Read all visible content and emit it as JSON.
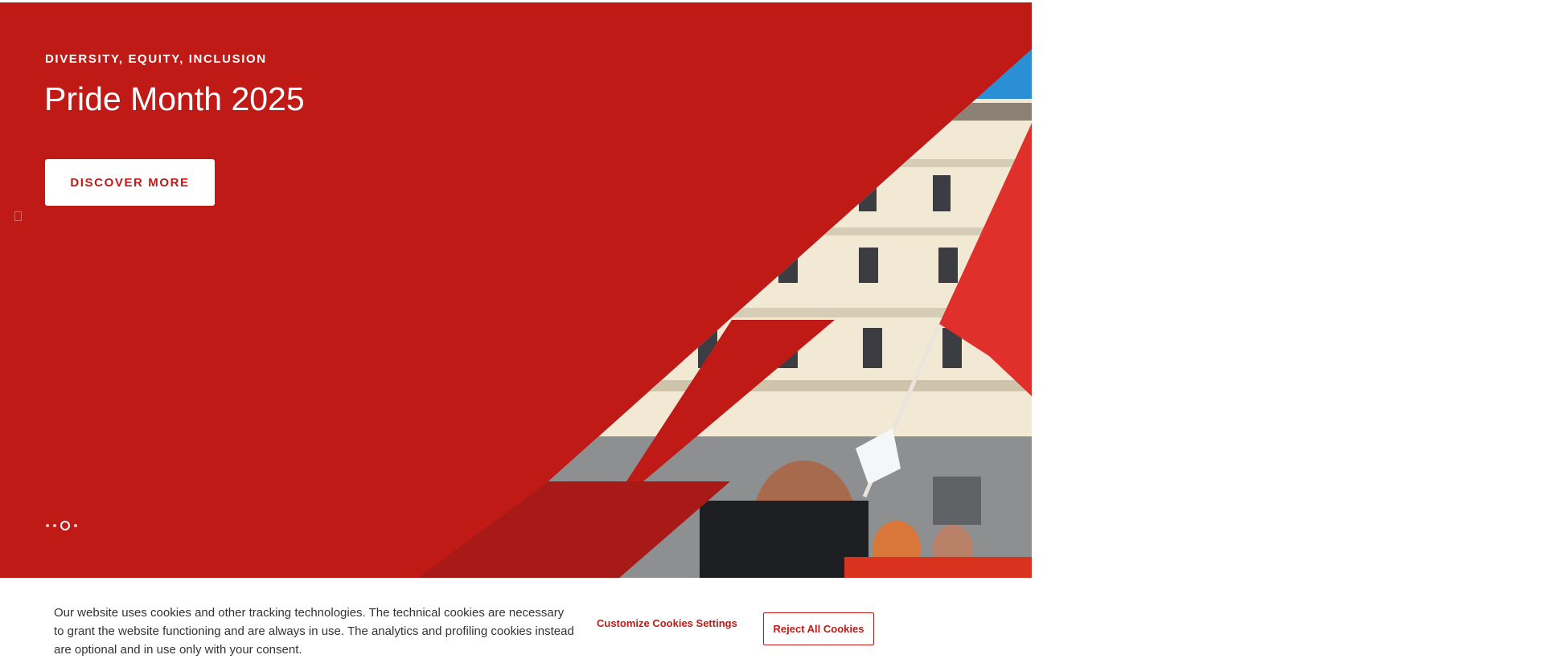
{
  "hero": {
    "eyebrow": "DIVERSITY, EQUITY, INCLUSION",
    "title": "Pride Month 2025",
    "cta_label": "DISCOVER MORE",
    "brand_color": "#c01a17",
    "slides_total": 4,
    "active_slide": 3
  },
  "cookie_banner": {
    "text": "Our website uses cookies and other tracking technologies. The technical cookies are necessary to grant the website functioning and are always in use. The analytics and profiling cookies instead are optional and in use only with your consent.",
    "customize_label": "Customize Cookies Settings",
    "reject_label": "Reject All Cookies"
  }
}
